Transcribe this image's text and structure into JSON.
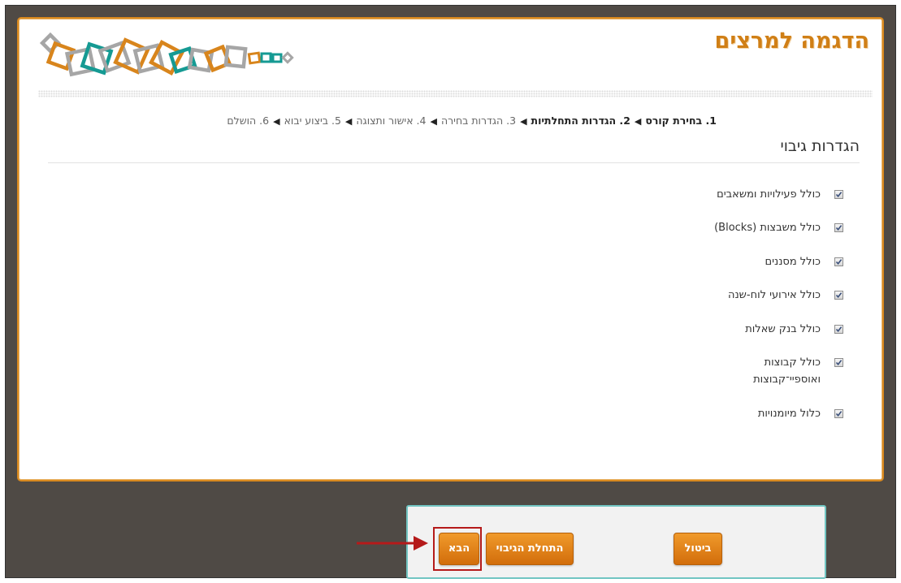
{
  "site": {
    "title": "הדגמה למרצים"
  },
  "steps": [
    {
      "label": "1. בחירת קורס",
      "state": "done"
    },
    {
      "label": "2. הגדרות התחלתיות",
      "state": "done"
    },
    {
      "label": "3. הגדרות בחירה",
      "state": "todo"
    },
    {
      "label": "4. אישור ותצוגה",
      "state": "todo"
    },
    {
      "label": "5. ביצוע יבוא",
      "state": "todo"
    },
    {
      "label": "6. הושלם",
      "state": "todo"
    }
  ],
  "step_separator": "◀",
  "section": {
    "heading": "הגדרות גיבוי"
  },
  "options": [
    {
      "label": "כולל פעילויות ומשאבים",
      "checked": true
    },
    {
      "label": "כולל משבצות (Blocks)",
      "checked": true
    },
    {
      "label": "כולל מסננים",
      "checked": true
    },
    {
      "label": "כולל אירועי לוח-שנה",
      "checked": true
    },
    {
      "label": "כולל בנק שאלות",
      "checked": true
    },
    {
      "label": "כולל קבוצות ואוספיי־קבוצות",
      "checked": true
    },
    {
      "label": "כלול מיומנויות",
      "checked": true
    }
  ],
  "buttons": {
    "next": "הבא",
    "start_backup": "התחלת הגיבוי",
    "cancel": "ביטול"
  },
  "colors": {
    "brand_orange": "#d07f16",
    "button_orange": "#e0841a",
    "teal": "#159a93",
    "gray": "#a6a6a6",
    "backdrop": "#4f4a45",
    "highlight_red": "#b51a1a"
  }
}
